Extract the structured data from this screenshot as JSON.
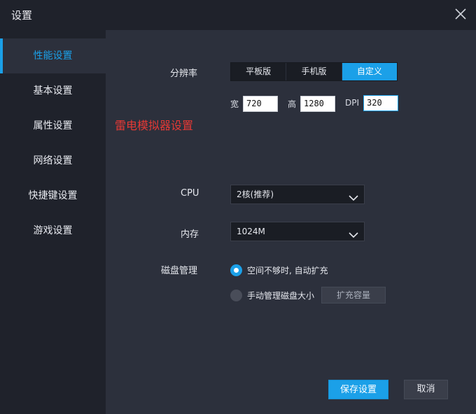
{
  "window": {
    "title": "设置"
  },
  "sidebar": {
    "items": [
      {
        "label": "性能设置",
        "active": true
      },
      {
        "label": "基本设置",
        "active": false
      },
      {
        "label": "属性设置",
        "active": false
      },
      {
        "label": "网络设置",
        "active": false
      },
      {
        "label": "快捷键设置",
        "active": false
      },
      {
        "label": "游戏设置",
        "active": false
      }
    ]
  },
  "resolution": {
    "label": "分辨率",
    "options": [
      "平板版",
      "手机版",
      "自定义"
    ],
    "selected": "自定义",
    "width_label": "宽",
    "width_value": "720",
    "height_label": "高",
    "height_value": "1280",
    "dpi_label": "DPI",
    "dpi_value": "320"
  },
  "watermark": "雷电模拟器设置",
  "cpu": {
    "label": "CPU",
    "value": "2核(推荐)"
  },
  "memory": {
    "label": "内存",
    "value": "1024M"
  },
  "disk": {
    "label": "磁盘管理",
    "option_auto": "空间不够时, 自动扩充",
    "option_manual": "手动管理磁盘大小",
    "selected": "auto",
    "expand_label": "扩充容量"
  },
  "footer": {
    "save_label": "保存设置",
    "cancel_label": "取消"
  },
  "colors": {
    "accent": "#1ba0e8",
    "background": "#1f222b",
    "panel": "#2c303c",
    "watermark": "#e53935"
  }
}
